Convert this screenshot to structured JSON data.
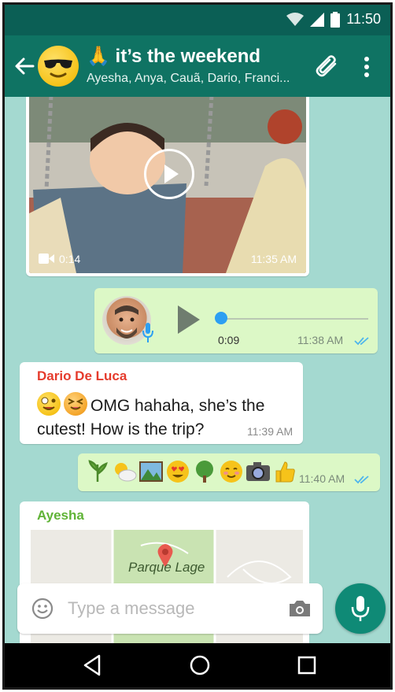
{
  "status_bar": {
    "time": "11:50"
  },
  "header": {
    "title": "🙏 it’s the weekend",
    "subtitle": "Ayesha, Anya, Cauã, Dario, Franci..."
  },
  "messages": {
    "video": {
      "duration": "0:14",
      "time": "11:35 AM"
    },
    "voice": {
      "length": "0:09",
      "time": "11:38 AM",
      "progress": 0
    },
    "dario": {
      "sender": "Dario De Luca",
      "sender_color": "#e53b2c",
      "text": "OMG hahaha, she’s the cutest! How is the trip?",
      "time": "11:39 AM"
    },
    "emoji": {
      "emojis": [
        "🌿",
        "⛅",
        "🏞️",
        "😍",
        "🌳",
        "☺️",
        "📷",
        "👍"
      ],
      "time": "11:40 AM"
    },
    "location": {
      "sender": "Ayesha",
      "sender_color": "#5fb336",
      "place": "Parque Lage"
    }
  },
  "composer": {
    "placeholder": "Type a message"
  },
  "colors": {
    "header": "#0f7363",
    "status_bar": "#0b5f55",
    "chat_bg": "#a4d9d0",
    "outgoing_bubble": "#dcf8c6",
    "read_ticks": "#4fb6ec",
    "mic_button": "#0f8a76"
  },
  "icons": {
    "back": "arrow-left-icon",
    "attach": "paperclip-icon",
    "menu": "more-vert-icon",
    "emoji": "smiley-icon",
    "camera": "camera-icon",
    "mic": "microphone-icon"
  }
}
